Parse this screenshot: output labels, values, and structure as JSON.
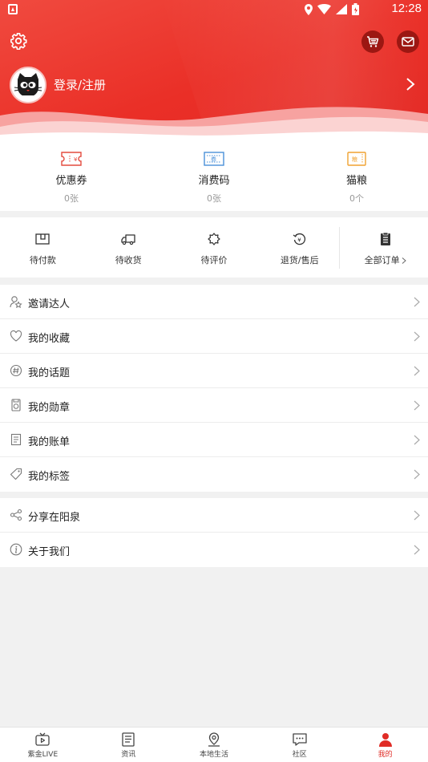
{
  "status_bar": {
    "time": "12:28"
  },
  "header": {
    "login_label": "登录/注册",
    "accent_color": "#e8332b"
  },
  "wallet": [
    {
      "name": "优惠券",
      "count": "0张",
      "icon": "coupon-icon",
      "color": "#e44b3f"
    },
    {
      "name": "消费码",
      "count": "0张",
      "icon": "voucher-code-icon",
      "color": "#4a90d9"
    },
    {
      "name": "猫粮",
      "count": "0个",
      "icon": "cat-food-icon",
      "color": "#f0a230"
    }
  ],
  "orders": [
    {
      "label": "待付款",
      "icon": "wallet-icon"
    },
    {
      "label": "待收货",
      "icon": "truck-icon"
    },
    {
      "label": "待评价",
      "icon": "review-icon"
    },
    {
      "label": "退货/售后",
      "icon": "refund-icon"
    },
    {
      "label": "全部订单",
      "icon": "clipboard-icon"
    }
  ],
  "menu_one": [
    {
      "label": "邀请达人",
      "icon": "invite-user-icon"
    },
    {
      "label": "我的收藏",
      "icon": "heart-icon"
    },
    {
      "label": "我的话题",
      "icon": "hashtag-icon"
    },
    {
      "label": "我的勋章",
      "icon": "medal-icon"
    },
    {
      "label": "我的账单",
      "icon": "bill-icon"
    },
    {
      "label": "我的标签",
      "icon": "tag-icon"
    }
  ],
  "menu_two": [
    {
      "label": "分享在阳泉",
      "icon": "share-icon"
    },
    {
      "label": "关于我们",
      "icon": "info-icon"
    }
  ],
  "tabbar": [
    {
      "label": "紫金LIVE",
      "icon": "tv-icon",
      "active": false
    },
    {
      "label": "资讯",
      "icon": "news-icon",
      "active": false
    },
    {
      "label": "本地生活",
      "icon": "location-icon",
      "active": false
    },
    {
      "label": "社区",
      "icon": "chat-icon",
      "active": false
    },
    {
      "label": "我的",
      "icon": "user-icon",
      "active": true
    }
  ]
}
